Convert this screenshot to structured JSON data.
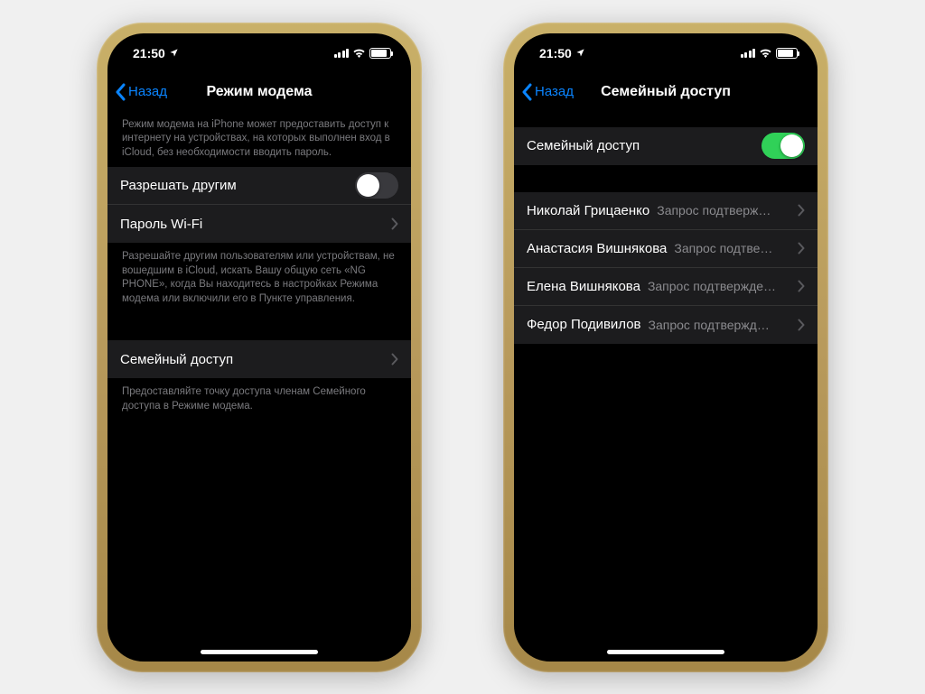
{
  "statusbar": {
    "time": "21:50"
  },
  "nav": {
    "back": "Назад"
  },
  "phone1": {
    "title": "Режим модема",
    "note_top": "Режим модема на iPhone может предоставить доступ к интернету на устройствах, на которых выполнен вход в iCloud, без необходимости вводить пароль.",
    "rows": {
      "allow_others": "Разрешать другим",
      "wifi_password": "Пароль Wi-Fi"
    },
    "note_mid": "Разрешайте другим пользователям или устройствам, не вошедшим в iCloud, искать Вашу общую сеть «NG PHONE», когда Вы находитесь в настройках Режима модема или включили его в Пункте управления.",
    "family": "Семейный доступ",
    "note_bottom": "Предоставляйте точку доступа членам Семейного доступа в Режиме модема."
  },
  "phone2": {
    "title": "Семейный доступ",
    "rows": {
      "family_toggle": "Семейный доступ"
    },
    "members": [
      {
        "name": "Николай Грицаенко",
        "status": "Запрос подтверж…"
      },
      {
        "name": "Анастасия Вишнякова",
        "status": "Запрос подтве…"
      },
      {
        "name": "Елена Вишнякова",
        "status": "Запрос подтвержде…"
      },
      {
        "name": "Федор Подивилов",
        "status": "Запрос подтвержд…"
      }
    ]
  }
}
